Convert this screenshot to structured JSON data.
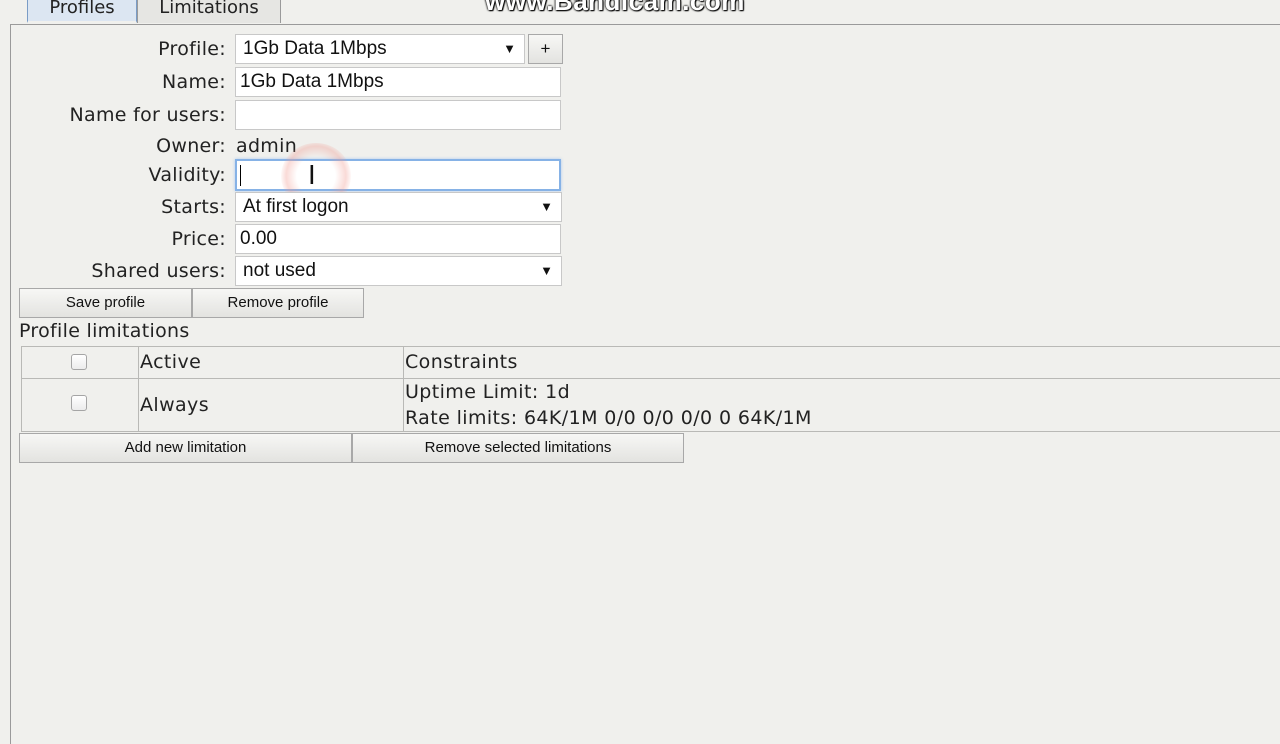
{
  "tabs": [
    {
      "label": "Profiles",
      "active": true
    },
    {
      "label": "Limitations",
      "active": false
    }
  ],
  "watermark": "www.Bandicam.com",
  "form": {
    "profile": {
      "label": "Profile:",
      "value": "1Gb Data 1Mbps",
      "add_button": "+"
    },
    "name": {
      "label": "Name:",
      "value": "1Gb Data 1Mbps"
    },
    "name_for_users": {
      "label": "Name for users:",
      "value": ""
    },
    "owner": {
      "label": "Owner:",
      "value": "admin"
    },
    "validity": {
      "label": "Validity:",
      "value": ""
    },
    "starts": {
      "label": "Starts:",
      "value": "At first logon"
    },
    "price": {
      "label": "Price:",
      "value": "0.00"
    },
    "shared_users": {
      "label": "Shared users:",
      "value": "not used"
    }
  },
  "buttons": {
    "save_profile": "Save profile",
    "remove_profile": "Remove profile",
    "add_limitation": "Add new limitation",
    "remove_limitations": "Remove selected limitations"
  },
  "limitations": {
    "title": "Profile limitations",
    "columns": [
      "",
      "Active",
      "Constraints"
    ],
    "rows": [
      {
        "checked": false,
        "active": "Always",
        "constraints": [
          "Uptime Limit: 1d",
          "Rate limits: 64K/1M 0/0 0/0 0/0 0 64K/1M"
        ]
      }
    ]
  },
  "colors": {
    "background": "#f0f0ed",
    "active_tab": "#dce6f2",
    "focus_border": "#86b2e6"
  }
}
